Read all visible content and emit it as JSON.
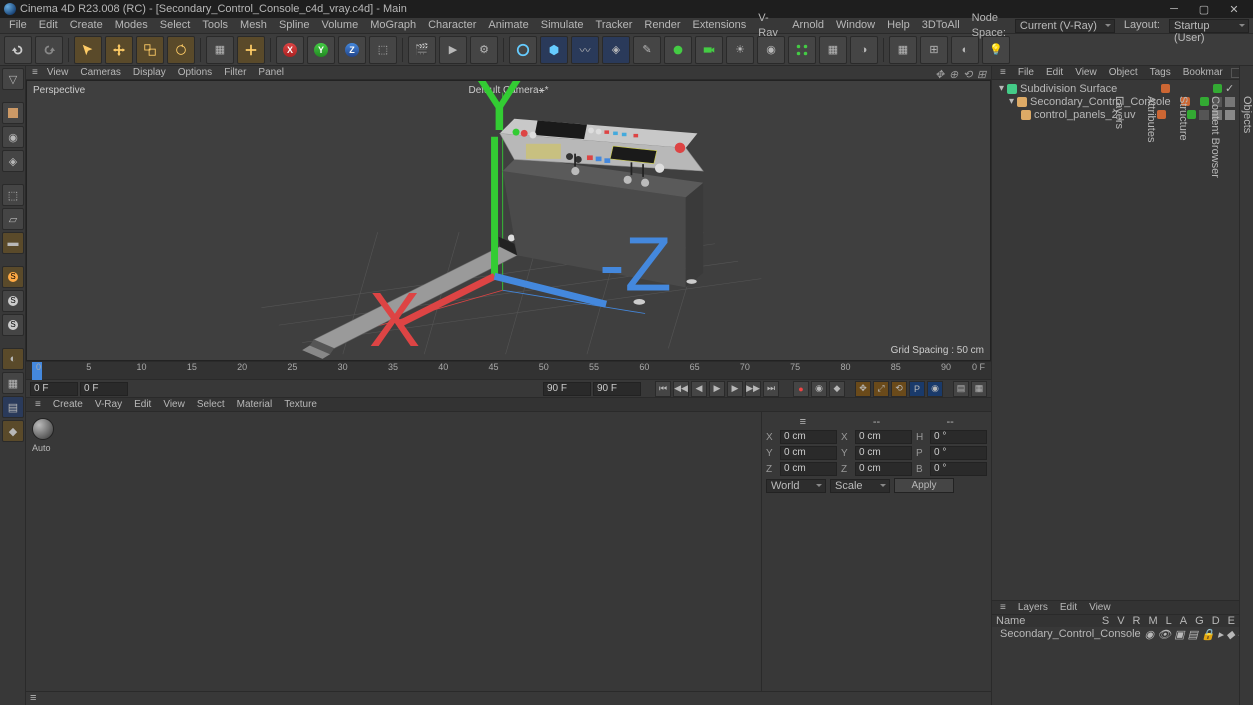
{
  "title": "Cinema 4D R23.008 (RC) - [Secondary_Control_Console_c4d_vray.c4d] - Main",
  "menu": [
    "File",
    "Edit",
    "Create",
    "Modes",
    "Select",
    "Tools",
    "Mesh",
    "Spline",
    "Volume",
    "MoGraph",
    "Character",
    "Animate",
    "Simulate",
    "Tracker",
    "Render",
    "Extensions",
    "V-Ray",
    "Arnold",
    "Window",
    "Help",
    "3DToAll"
  ],
  "nodeSpaceLabel": "Node Space:",
  "nodeSpace": "Current (V-Ray)",
  "layoutLabel": "Layout:",
  "layout": "Startup (User)",
  "vpMenu": [
    "View",
    "Cameras",
    "Display",
    "Options",
    "Filter",
    "Panel"
  ],
  "vpLabelTL": "Perspective",
  "vpLabelTC": "Default Camera⚹*",
  "vpLabelBR": "Grid Spacing : 50 cm",
  "ruler": {
    "ticks": [
      "0",
      "5",
      "10",
      "15",
      "20",
      "25",
      "30",
      "35",
      "40",
      "45",
      "50",
      "55",
      "60",
      "65",
      "70",
      "75",
      "80",
      "85",
      "90"
    ],
    "rightLabel": "0 F"
  },
  "play": {
    "startA": "0 F",
    "startB": "0 F",
    "endA": "90 F",
    "endB": "90 F"
  },
  "subMenu": [
    "Create",
    "V-Ray",
    "Edit",
    "View",
    "Select",
    "Material",
    "Texture"
  ],
  "autokLabel": "Auto",
  "coords": {
    "row1": {
      "a": "X",
      "av": "0 cm",
      "b": "X",
      "bv": "0 cm",
      "c": "H",
      "cv": "0 °"
    },
    "row2": {
      "a": "Y",
      "av": "0 cm",
      "b": "Y",
      "bv": "0 cm",
      "c": "P",
      "cv": "0 °"
    },
    "row3": {
      "a": "Z",
      "av": "0 cm",
      "b": "Z",
      "bv": "0 cm",
      "c": "B",
      "cv": "0 °"
    },
    "modeA": "World",
    "modeB": "Scale",
    "apply": "Apply"
  },
  "objMenu": [
    "File",
    "Edit",
    "View",
    "Object",
    "Tags",
    "Bookmar"
  ],
  "objects": [
    {
      "name": "Subdivision Surface",
      "ind": 0,
      "ico": "subd"
    },
    {
      "name": "Secondary_Control_Console",
      "ind": 1,
      "ico": "mesh"
    },
    {
      "name": "control_panels_2_uv",
      "ind": 2,
      "ico": "mesh"
    }
  ],
  "layersMenu": [
    "Layers",
    "Edit",
    "View"
  ],
  "layersHead": [
    "Name",
    "S",
    "V",
    "R",
    "M",
    "L",
    "A",
    "G",
    "D",
    "E"
  ],
  "layerItem": "Secondary_Control_Console",
  "rightTabs": [
    "Objects",
    "Content Browser",
    "Structure",
    "Attributes",
    "Layers"
  ]
}
